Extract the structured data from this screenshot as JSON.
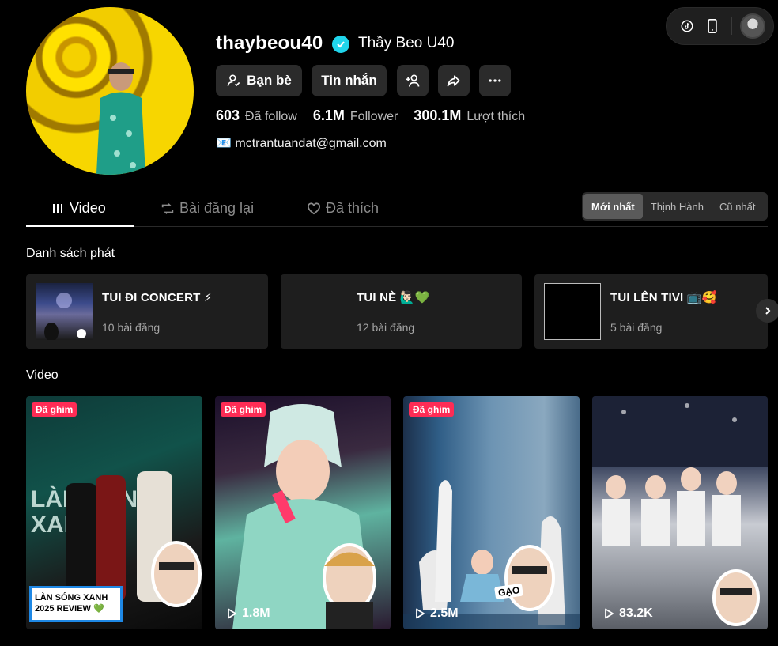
{
  "profile": {
    "username": "thaybeou40",
    "nickname": "Thầy Beo U40",
    "bio": "📧 mctrantuandat@gmail.com"
  },
  "buttons": {
    "friends": "Bạn bè",
    "message": "Tin nhắn"
  },
  "stats": [
    {
      "value": "603",
      "label": "Đã follow"
    },
    {
      "value": "6.1M",
      "label": "Follower"
    },
    {
      "value": "300.1M",
      "label": "Lượt thích"
    }
  ],
  "tabs": {
    "video": "Video",
    "repost": "Bài đăng lại",
    "liked": "Đã thích"
  },
  "sort": {
    "latest": "Mới nhất",
    "popular": "Thịnh Hành",
    "oldest": "Cũ nhất"
  },
  "sections": {
    "playlists": "Danh sách phát",
    "videos": "Video"
  },
  "playlists": [
    {
      "title": "TUI ĐI CONCERT ⚡",
      "count": "10 bài đăng"
    },
    {
      "title": "TUI NÈ 🙋🏻‍♂️💚",
      "count": "12 bài đăng"
    },
    {
      "title": "TUI LÊN TIVI 📺🥰",
      "count": "5 bài đăng"
    }
  ],
  "videos": [
    {
      "pinned": "Đã ghim",
      "views": "",
      "overlay": "LÀN SÓNG XANH 2025 REVIEW 💚"
    },
    {
      "pinned": "Đã ghim",
      "views": "1.8M"
    },
    {
      "pinned": "Đã ghim",
      "views": "2.5M",
      "caption": "GẠO"
    },
    {
      "pinned": "",
      "views": "83.2K"
    }
  ],
  "colors": {
    "accent": "#fe2c55",
    "verified": "#20d5ec",
    "background": "#000000"
  }
}
